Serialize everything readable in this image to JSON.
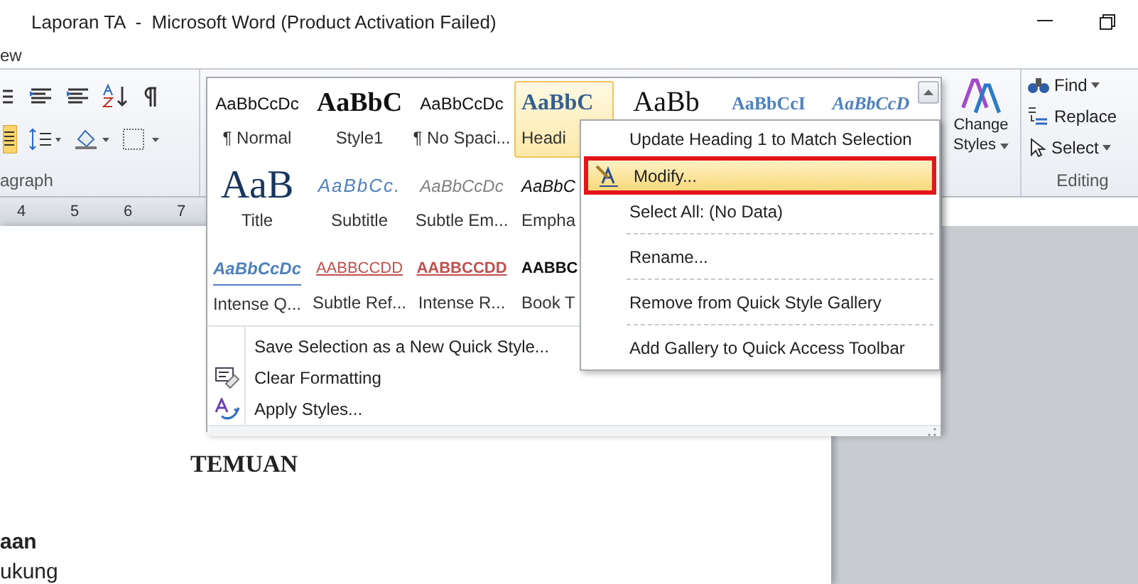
{
  "window": {
    "title": "Laporan TA  -  Microsoft Word (Product Activation Failed)"
  },
  "ribbon_tab": {
    "label": "ew"
  },
  "paragraph_group": {
    "label": "agraph",
    "justify_on": true
  },
  "change_styles": {
    "label": "Change Styles"
  },
  "editing_group": {
    "label": "Editing",
    "items": [
      {
        "label": "Find",
        "kind": "find",
        "dropdown": true
      },
      {
        "label": "Replace",
        "kind": "replace",
        "dropdown": false
      },
      {
        "label": "Select",
        "kind": "select",
        "dropdown": true
      }
    ]
  },
  "ruler": {
    "numbers": [
      "4",
      "5",
      "6",
      "7"
    ]
  },
  "document": {
    "heading": "TEMUAN",
    "lines": [
      {
        "text": "aan",
        "bold": true
      },
      {
        "text": "ukung",
        "bold": false
      }
    ]
  },
  "style_gallery": {
    "rows": [
      [
        {
          "sample": "AaBbCcDc",
          "label": "¶ Normal",
          "kind": "normal",
          "selected": false
        },
        {
          "sample": "AaBbC",
          "label": "Style1",
          "kind": "serif-bold",
          "selected": false
        },
        {
          "sample": "AaBbCcDc",
          "label": "¶ No Spaci...",
          "kind": "normal",
          "selected": false
        },
        {
          "sample": "AaBbC",
          "label": "Headi",
          "kind": "heading",
          "selected": true
        },
        {
          "sample": "AaBb",
          "kind": "serif-big",
          "selected": false
        },
        {
          "sample": "AaBbCcI",
          "kind": "heading-small",
          "selected": false
        },
        {
          "sample": "AaBbCcD",
          "kind": "heading-italic",
          "selected": false
        }
      ],
      [
        {
          "sample": "AaB",
          "label": "Title",
          "kind": "title",
          "selected": false
        },
        {
          "sample": "AaBbCc.",
          "label": "Subtitle",
          "kind": "subtitle",
          "selected": false
        },
        {
          "sample": "AaBbCcDc",
          "label": "Subtle Em...",
          "kind": "subtle",
          "selected": false
        },
        {
          "sample": "AaBbC",
          "label": "Empha",
          "kind": "emphasis",
          "selected": false
        }
      ],
      [
        {
          "sample": "AaBbCcDc",
          "label": "Intense Q...",
          "kind": "intense-quote",
          "selected": false
        },
        {
          "sample": "AABBCCDD",
          "label": "Subtle Ref...",
          "kind": "subtle-ref",
          "selected": false
        },
        {
          "sample": "AABBCCDD",
          "label": "Intense R...",
          "kind": "intense-ref",
          "selected": false
        },
        {
          "sample": "AABBC",
          "label": "Book T",
          "kind": "book",
          "selected": false
        }
      ]
    ],
    "actions": [
      {
        "label": "Save Selection as a New Quick Style...",
        "kind": "plain"
      },
      {
        "label": "Clear Formatting",
        "kind": "clear"
      },
      {
        "label": "Apply Styles...",
        "kind": "apply"
      }
    ]
  },
  "context_menu": {
    "items": [
      {
        "kind": "item",
        "label": "Update Heading 1 to Match Selection",
        "highlighted": false,
        "marked": false
      },
      {
        "kind": "item",
        "label": "Modify...",
        "highlighted": true,
        "marked": true,
        "icon": true
      },
      {
        "kind": "item",
        "label": "Select All: (No Data)",
        "highlighted": false,
        "marked": false
      },
      {
        "kind": "separator"
      },
      {
        "kind": "item",
        "label": "Rename...",
        "highlighted": false,
        "marked": false
      },
      {
        "kind": "separator"
      },
      {
        "kind": "item",
        "label": "Remove from Quick Style Gallery",
        "highlighted": false,
        "marked": false
      },
      {
        "kind": "separator"
      },
      {
        "kind": "item",
        "label": "Add Gallery to Quick Access Toolbar",
        "highlighted": false,
        "marked": false
      }
    ]
  }
}
